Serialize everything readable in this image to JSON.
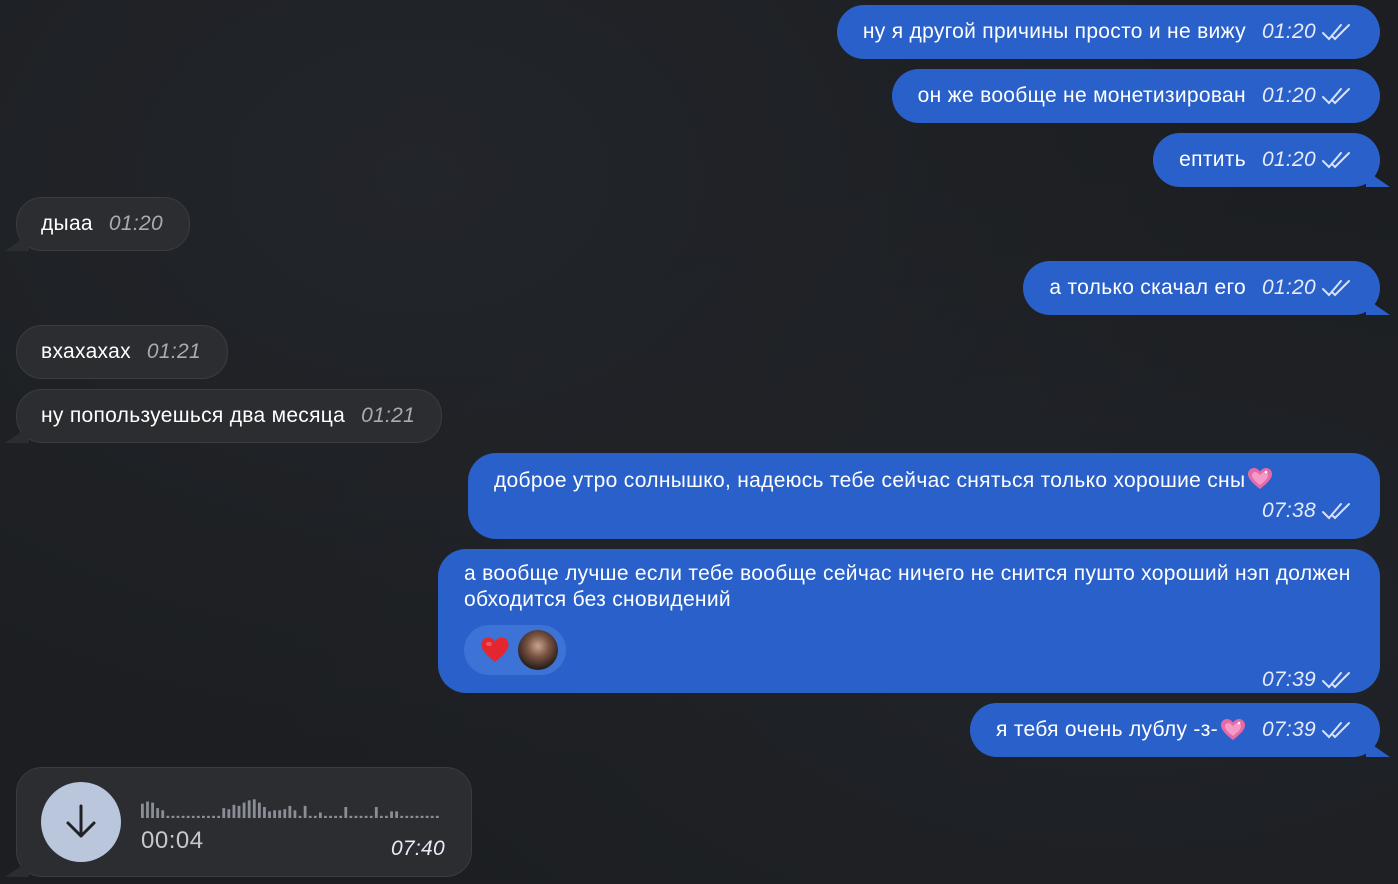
{
  "messages": [
    {
      "id": "m1",
      "dir": "out",
      "text": "ну я другой причины просто и не вижу",
      "time": "01:20"
    },
    {
      "id": "m2",
      "dir": "out",
      "text": "он же вообще не монетизирован",
      "time": "01:20"
    },
    {
      "id": "m3",
      "dir": "out",
      "text": "ептить",
      "time": "01:20"
    },
    {
      "id": "m4",
      "dir": "in",
      "text": "дыаа",
      "time": "01:20"
    },
    {
      "id": "m5",
      "dir": "out",
      "text": "а только скачал его",
      "time": "01:20"
    },
    {
      "id": "m6",
      "dir": "in",
      "text": "вхахахах",
      "time": "01:21"
    },
    {
      "id": "m7",
      "dir": "in",
      "text": "ну попользуешься два месяца",
      "time": "01:21"
    },
    {
      "id": "m8",
      "dir": "out",
      "text": "доброе утро солнышко, надеюсь тебе сейчас сняться только хорошие сны",
      "emoji": "sparkling-heart",
      "time": "07:38"
    },
    {
      "id": "m9",
      "dir": "out",
      "text": "а вообще лучше если тебе вообще сейчас ничего не снится пушто хороший нэп должен обходится без сновидений",
      "time": "07:39",
      "reaction": "red-heart"
    },
    {
      "id": "m10",
      "dir": "out",
      "text": "я тебя очень лублу -з-",
      "emoji": "sparkling-heart",
      "time": "07:39"
    }
  ],
  "voice_message": {
    "dir": "in",
    "duration": "00:04",
    "time": "07:40",
    "icon": "download-arrow-icon",
    "waveform": [
      0.65,
      0.75,
      0.7,
      0.45,
      0.35,
      0.1,
      0.1,
      0.1,
      0.1,
      0.1,
      0.1,
      0.1,
      0.1,
      0.1,
      0.1,
      0.1,
      0.45,
      0.4,
      0.6,
      0.55,
      0.7,
      0.8,
      0.85,
      0.7,
      0.5,
      0.3,
      0.35,
      0.35,
      0.4,
      0.55,
      0.35,
      0.1,
      0.55,
      0.1,
      0.1,
      0.25,
      0.1,
      0.1,
      0.1,
      0.1,
      0.5,
      0.1,
      0.1,
      0.1,
      0.1,
      0.1,
      0.5,
      0.1,
      0.1,
      0.3,
      0.3,
      0.1,
      0.1,
      0.1,
      0.1,
      0.1,
      0.1,
      0.1,
      0.1
    ]
  },
  "colors": {
    "background": "#1c1e21",
    "outgoing_bubble": "#2a60c9",
    "incoming_bubble": "#2b2d31",
    "reaction_pill": "#3d72d6",
    "read_check": "#d7e2f7"
  }
}
